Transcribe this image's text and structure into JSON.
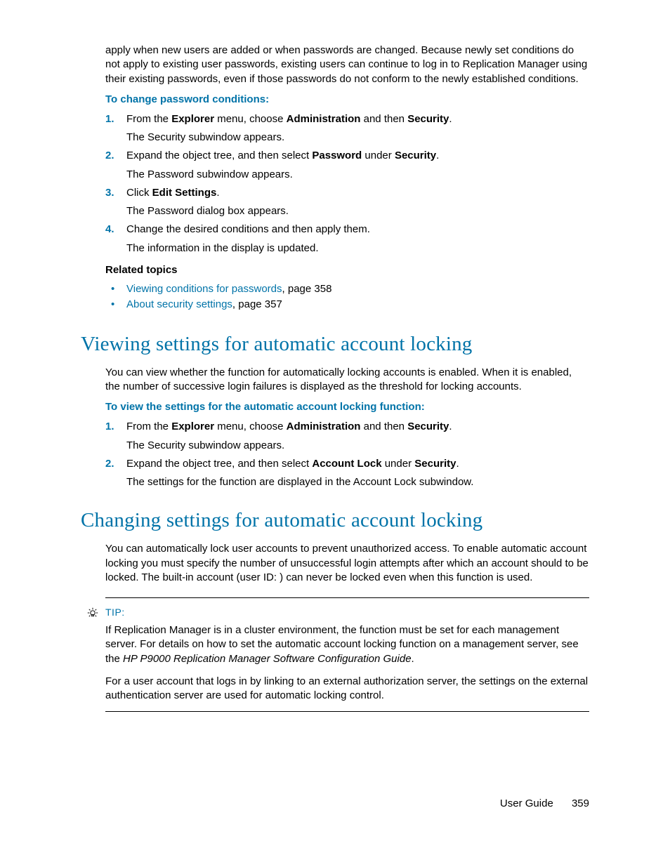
{
  "intro_para": "apply when new users are added or when passwords are changed. Because newly set conditions do not apply to existing user passwords, existing users can continue to log in to Replication Manager using their existing passwords, even if those passwords do not conform to the newly established conditions.",
  "proc1": {
    "heading": "To change password conditions:",
    "items": [
      {
        "num": "1.",
        "pre": "From the ",
        "b1": "Explorer",
        "mid1": " menu, choose ",
        "b2": "Administration",
        "mid2": " and then ",
        "b3": "Security",
        "post": ".",
        "after": "The Security subwindow appears."
      },
      {
        "num": "2.",
        "pre": "Expand the object tree, and then select ",
        "b1": "Password",
        "mid1": " under ",
        "b2": "Security",
        "post": ".",
        "after": "The Password subwindow appears."
      },
      {
        "num": "3.",
        "pre": "Click ",
        "b1": "Edit Settings",
        "post": ".",
        "after": "The Password dialog box appears."
      },
      {
        "num": "4.",
        "text": "Change the desired conditions and then apply them.",
        "after": "The information in the display is updated."
      }
    ]
  },
  "related": {
    "heading": "Related topics",
    "items": [
      {
        "link": "Viewing conditions for passwords",
        "suffix": ", page 358"
      },
      {
        "link": "About security settings",
        "suffix": ", page 357"
      }
    ]
  },
  "sec1": {
    "title": "Viewing settings for automatic account locking",
    "para": "You can view whether the function for automatically locking accounts is enabled. When it is enabled, the number of successive login failures is displayed as the threshold for locking accounts.",
    "proc_heading": "To view the settings for the automatic account locking function:",
    "items": [
      {
        "num": "1.",
        "pre": "From the ",
        "b1": "Explorer",
        "mid1": " menu, choose ",
        "b2": "Administration",
        "mid2": " and then ",
        "b3": "Security",
        "post": ".",
        "after": "The Security subwindow appears."
      },
      {
        "num": "2.",
        "pre": "Expand the object tree, and then select ",
        "b1": "Account Lock",
        "mid1": " under ",
        "b2": "Security",
        "post": ".",
        "after": "The settings for the function are displayed in the Account Lock subwindow."
      }
    ]
  },
  "sec2": {
    "title": "Changing settings for automatic account locking",
    "para": "You can automatically lock user accounts to prevent unauthorized access. To enable automatic account locking you must specify the number of unsuccessful login attempts after which an account should to be locked. The built-in account (user ID:              ) can never be locked even when this function is used."
  },
  "tip": {
    "label": "TIP:",
    "p1a": "If Replication Manager is in a cluster environment, the function must be set for each management server. For details on how to set the automatic account locking function on a management server, see the ",
    "p1i": "HP P9000 Replication Manager Software Configuration Guide",
    "p1b": ".",
    "p2": "For a user account that logs in by linking to an external authorization server, the settings on the external authentication server are used for automatic locking control."
  },
  "footer": {
    "label": "User Guide",
    "page": "359"
  }
}
